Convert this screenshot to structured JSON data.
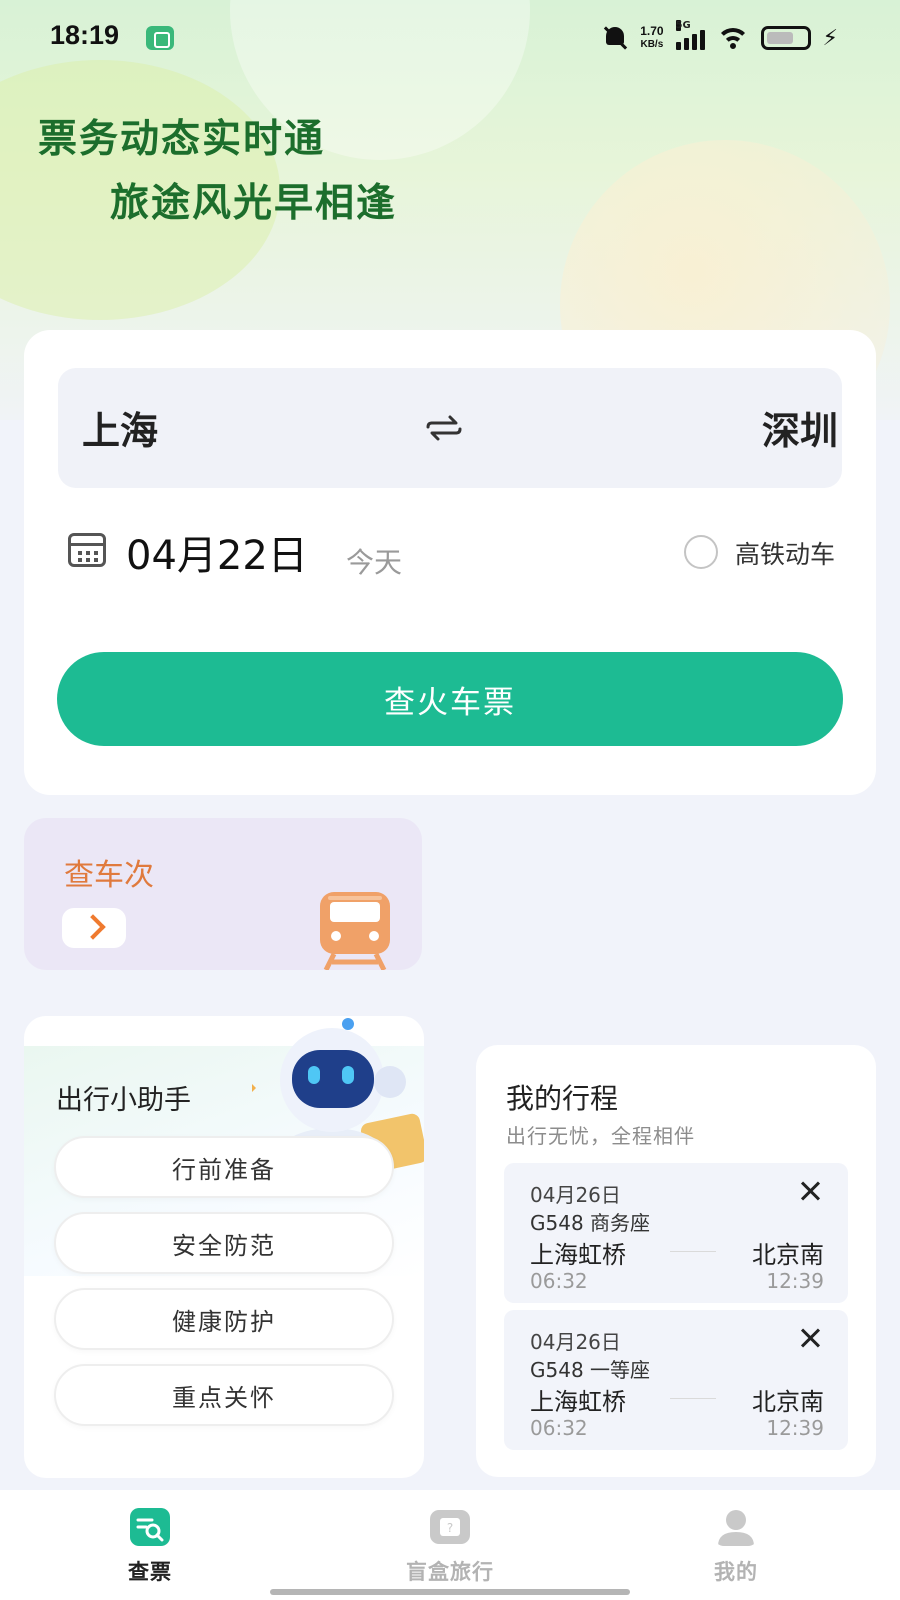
{
  "status_bar": {
    "time": "18:19",
    "net_speed_value": "1.70",
    "net_speed_unit": "KB/s",
    "network_type": "5G",
    "icons": [
      "app-notification-icon",
      "bell-off-icon",
      "signal-icon",
      "wifi-icon",
      "battery-icon",
      "charging-icon"
    ]
  },
  "hero": {
    "line1": "票务动态实时通",
    "line2": "旅途风光早相逢"
  },
  "search": {
    "from": "上海",
    "to": "深圳",
    "date": "04月22日",
    "date_hint": "今天",
    "hsr_only_label": "高铁动车",
    "hsr_only_checked": false,
    "button_label": "查火车票"
  },
  "train_number": {
    "title": "查车次"
  },
  "assistant": {
    "title": "出行小助手",
    "buttons": [
      "行前准备",
      "安全防范",
      "健康防护",
      "重点关怀"
    ]
  },
  "trips": {
    "title": "我的行程",
    "subtitle": "出行无忧，全程相伴",
    "items": [
      {
        "date": "04月26日",
        "train": "G548 商务座",
        "from": "上海虹桥",
        "to": "北京南",
        "depart": "06:32",
        "arrive": "12:39"
      },
      {
        "date": "04月26日",
        "train": "G548 一等座",
        "from": "上海虹桥",
        "to": "北京南",
        "depart": "06:32",
        "arrive": "12:39"
      }
    ]
  },
  "bottom_nav": {
    "items": [
      {
        "label": "查票",
        "active": true
      },
      {
        "label": "盲盒旅行",
        "active": false
      },
      {
        "label": "我的",
        "active": false
      }
    ]
  },
  "colors": {
    "accent": "#1dbb93",
    "slogan": "#1c6e2c",
    "train_number_title": "#e07a3d",
    "nav_active": "#222222",
    "nav_inactive": "#b3b3b3"
  }
}
